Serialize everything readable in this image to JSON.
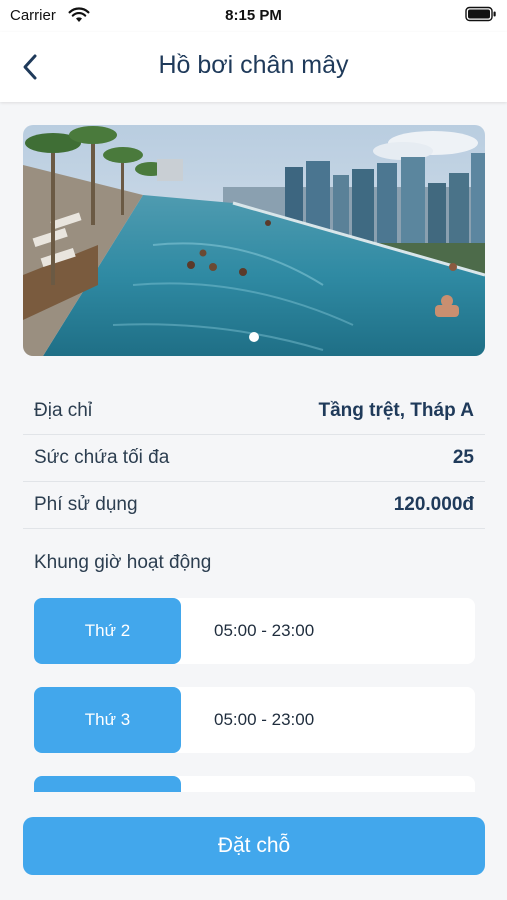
{
  "status_bar": {
    "carrier": "Carrier",
    "time": "8:15 PM"
  },
  "header": {
    "title": "Hồ bơi chân mây",
    "back_icon": "chevron-left-icon"
  },
  "gallery": {
    "description_icon": "pool-photo",
    "active_index": 0,
    "count": 1
  },
  "info": [
    {
      "label": "Địa chỉ",
      "value": "Tầng trệt, Tháp A"
    },
    {
      "label": "Sức chứa tối đa",
      "value": "25"
    },
    {
      "label": "Phí sử dụng",
      "value": "120.000đ"
    }
  ],
  "schedule": {
    "title": "Khung giờ hoạt động",
    "items": [
      {
        "day": "Thứ 2",
        "hours": "05:00 - 23:00"
      },
      {
        "day": "Thứ 3",
        "hours": "05:00 - 23:00"
      },
      {
        "day": "",
        "hours": ""
      }
    ]
  },
  "actions": {
    "book_label": "Đặt chỗ"
  },
  "colors": {
    "accent": "#42a7ec",
    "title_text": "#1f3a5a",
    "background": "#f5f6f8"
  }
}
